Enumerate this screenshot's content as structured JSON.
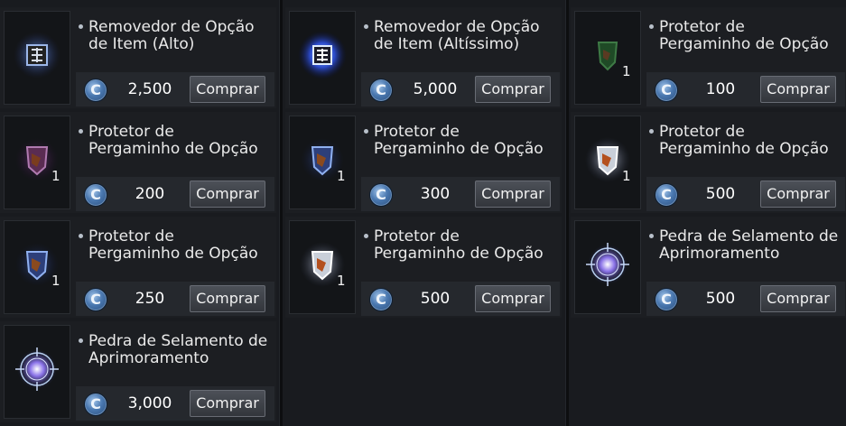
{
  "shop": {
    "currency_icon": "c-coin-icon",
    "currency_symbol": "C",
    "colors": {
      "background": "#191b1f",
      "card": "#1c1e22",
      "price_bar": "#25282d",
      "button": "#3f4249",
      "coin": "#4a78b0"
    },
    "items": [
      {
        "name": "Removedor de Opção\nde Item (Alto)",
        "price": "2,500",
        "buy_label": "Comprar",
        "quantity": "",
        "icon": "option-remover-icon"
      },
      {
        "name": "Removedor de Opção\nde Item (Altíssimo)",
        "price": "5,000",
        "buy_label": "Comprar",
        "quantity": "",
        "icon": "option-remover-glowing-icon"
      },
      {
        "name": "Protetor de\nPergaminho de Opção",
        "price": "100",
        "buy_label": "Comprar",
        "quantity": "1",
        "icon": "green-shield-icon"
      },
      {
        "name": "Protetor de\nPergaminho de Opção",
        "price": "200",
        "buy_label": "Comprar",
        "quantity": "1",
        "icon": "purple-shield-icon"
      },
      {
        "name": "Protetor de\nPergaminho de Opção",
        "price": "300",
        "buy_label": "Comprar",
        "quantity": "1",
        "icon": "blue-shield-icon"
      },
      {
        "name": "Protetor de\nPergaminho de Opção",
        "price": "500",
        "buy_label": "Comprar",
        "quantity": "1",
        "icon": "white-shield-icon"
      },
      {
        "name": "Protetor de\nPergaminho de Opção",
        "price": "250",
        "buy_label": "Comprar",
        "quantity": "1",
        "icon": "blue-shield-icon"
      },
      {
        "name": "Protetor de\nPergaminho de Opção",
        "price": "500",
        "buy_label": "Comprar",
        "quantity": "1",
        "icon": "white-shield-icon"
      },
      {
        "name": "Pedra de Selamento de\nAprimoramento",
        "price": "500",
        "buy_label": "Comprar",
        "quantity": "",
        "icon": "sealing-stone-icon"
      },
      {
        "name": "Pedra de Selamento de\nAprimoramento",
        "price": "3,000",
        "buy_label": "Comprar",
        "quantity": "",
        "icon": "sealing-stone-icon"
      }
    ]
  }
}
